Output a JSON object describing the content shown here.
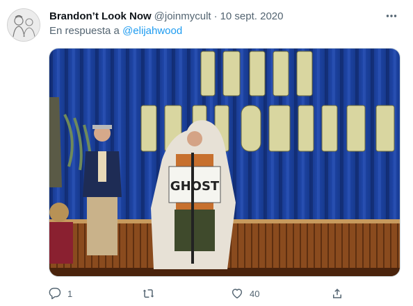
{
  "tweet": {
    "author": {
      "display_name": "Brandon’t Look Now",
      "handle": "@joinmycult",
      "avatar_icon": "sketch-avatar"
    },
    "separator": "·",
    "date": "10 sept. 2020",
    "reply_prefix": "En respuesta a",
    "reply_to": "@elijahwood",
    "media": {
      "banner_text": "HAPPY HALLOWEEN",
      "sign_text": "GHOST"
    },
    "actions": {
      "reply_count": "1",
      "retweet_count": "",
      "like_count": "40"
    },
    "icons": {
      "more": "more-dots-icon",
      "reply": "reply-icon",
      "retweet": "retweet-icon",
      "like": "heart-icon",
      "share": "share-icon"
    },
    "colors": {
      "link": "#1d9bf0",
      "secondary_text": "#536471",
      "curtain": "#1c3f9a"
    }
  }
}
